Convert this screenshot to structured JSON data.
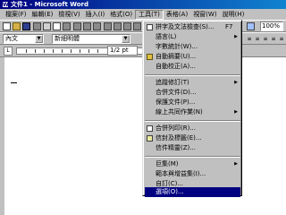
{
  "window": {
    "title": "文件1 - Microsoft Word"
  },
  "menubar": [
    {
      "label": "檔案(F)"
    },
    {
      "label": "編輯(E)"
    },
    {
      "label": "檢視(V)"
    },
    {
      "label": "插入(I)"
    },
    {
      "label": "格式(O)"
    },
    {
      "label": "工具(T)"
    },
    {
      "label": "表格(A)"
    },
    {
      "label": "視窗(W)"
    },
    {
      "label": "說明(H)"
    }
  ],
  "formatting": {
    "style": "內文",
    "font": "新細明體",
    "zoom": "100%",
    "size": "1/2 pt"
  },
  "tools_menu": {
    "items": [
      {
        "label": "拼字及文法檢查(S)...",
        "shortcut": "F7",
        "icon": "spelling-icon"
      },
      {
        "label": "語言(L)",
        "submenu": true
      },
      {
        "label": "字數統計(W)..."
      },
      {
        "label": "自動摘要(U)...",
        "icon": "autosummarize-icon"
      },
      {
        "label": "自動校正(A)..."
      },
      {
        "label": "追蹤修訂(T)",
        "submenu": true
      },
      {
        "label": "合併文件(D)..."
      },
      {
        "label": "保護文件(P)..."
      },
      {
        "label": "線上共同作業(N)",
        "submenu": true
      },
      {
        "label": "合併列印(R)...",
        "icon": "mail-merge-icon"
      },
      {
        "label": "信封及標籤(E)...",
        "icon": "envelope-icon"
      },
      {
        "label": "信件精靈(Z)..."
      },
      {
        "label": "巨集(M)",
        "submenu": true
      },
      {
        "label": "範本與增益集(I)..."
      },
      {
        "label": "自訂(C)..."
      },
      {
        "label": "選項(O)...",
        "selected": true
      }
    ]
  },
  "colors": {
    "title_bar": "#000080",
    "selection": "#000080",
    "menu_bg": "#c0c0c0"
  }
}
